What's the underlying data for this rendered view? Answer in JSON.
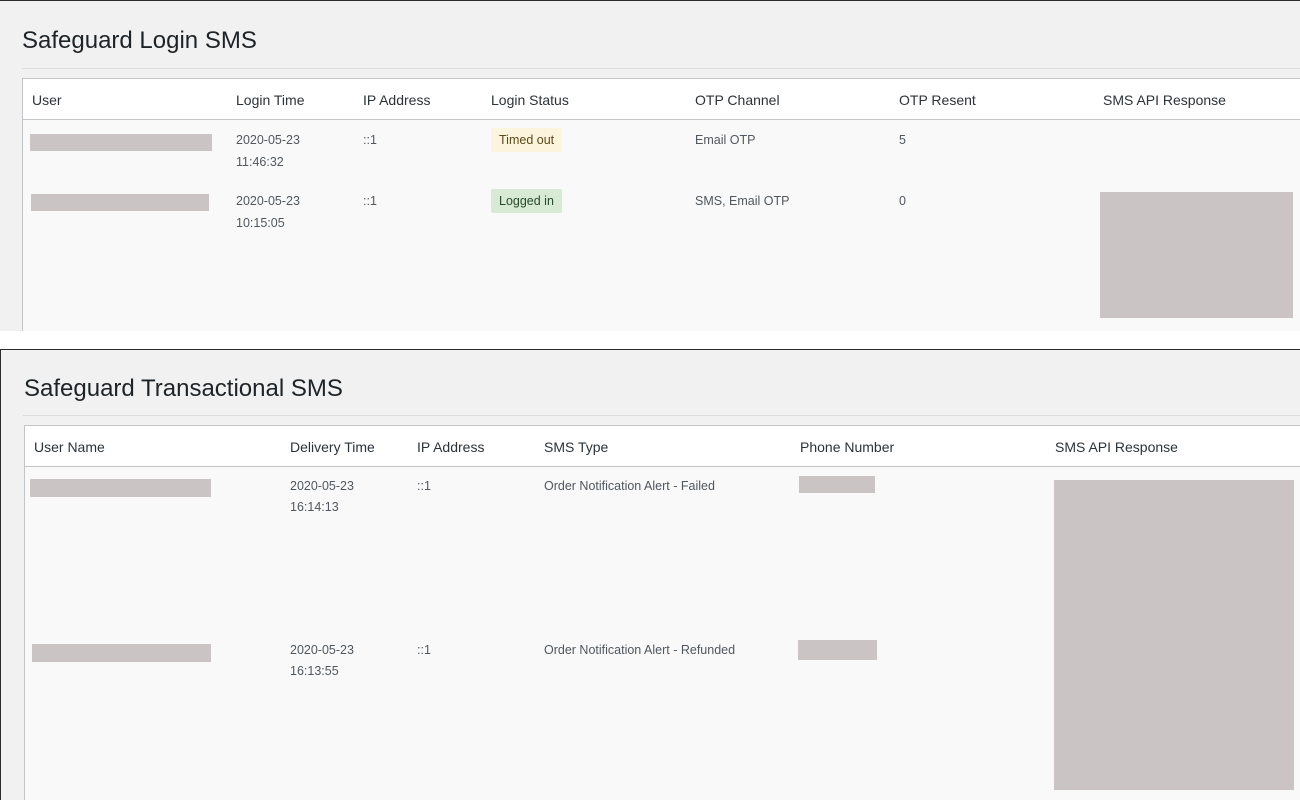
{
  "login_panel": {
    "title": "Safeguard Login SMS",
    "columns": [
      "User",
      "Login Time",
      "IP Address",
      "Login Status",
      "OTP Channel",
      "OTP Resent",
      "SMS API Response"
    ],
    "rows": [
      {
        "date": "2020-05-23",
        "time": "11:46:32",
        "ip": "::1",
        "status": "Timed out",
        "status_type": "warning",
        "channel": "Email OTP",
        "resent": "5"
      },
      {
        "date": "2020-05-23",
        "time": "10:15:05",
        "ip": "::1",
        "status": "Logged in",
        "status_type": "success",
        "channel": "SMS, Email OTP",
        "resent": "0"
      }
    ]
  },
  "transactional_panel": {
    "title": "Safeguard Transactional SMS",
    "columns": [
      "User Name",
      "Delivery Time",
      "IP Address",
      "SMS Type",
      "Phone Number",
      "SMS API Response"
    ],
    "rows": [
      {
        "date": "2020-05-23",
        "time": "16:14:13",
        "ip": "::1",
        "sms_type": "Order Notification Alert - Failed"
      },
      {
        "date": "2020-05-23",
        "time": "16:13:55",
        "ip": "::1",
        "sms_type": "Order Notification Alert - Refunded"
      }
    ]
  },
  "colors": {
    "redacted": "#cac4c4",
    "badge_warning": "#fcf4dc",
    "badge_success": "#d6ead4"
  }
}
